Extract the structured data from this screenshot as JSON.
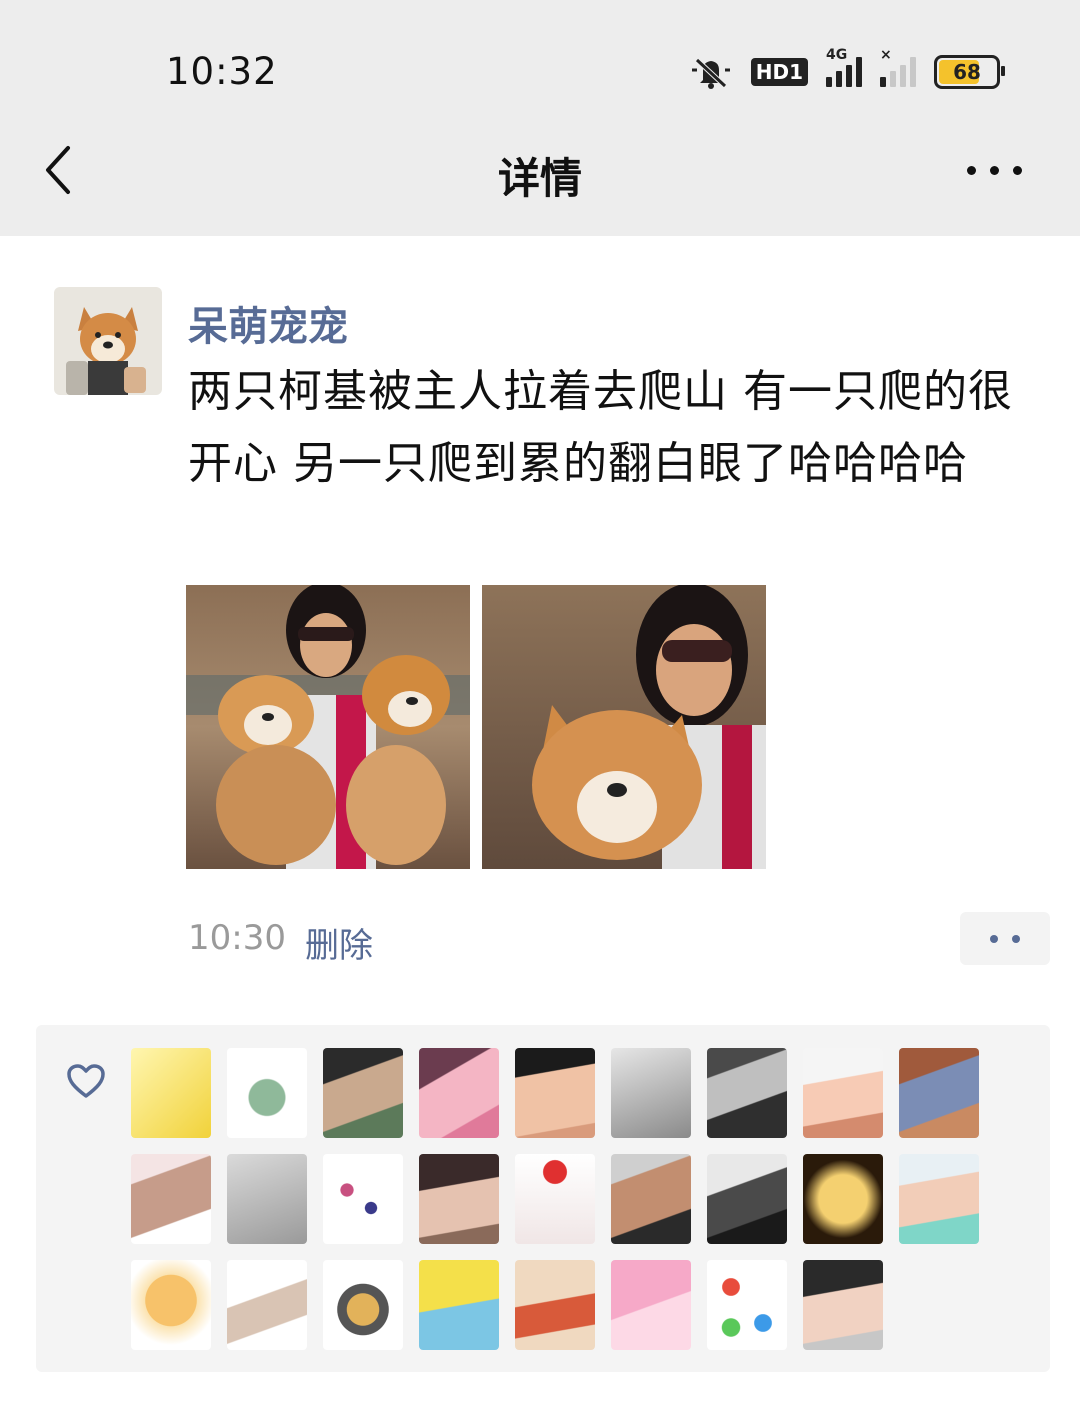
{
  "status_bar": {
    "time": "10:32",
    "hd_label": "HD1",
    "network_label": "4G",
    "battery": "68",
    "battery_color": "#f4c22c"
  },
  "header": {
    "title": "详情"
  },
  "post": {
    "author": "呆萌宠宠",
    "text": "两只柯基被主人拉着去爬山 有一只爬的很开心 另一只爬到累的翻白眼了哈哈哈哈",
    "time": "10:30",
    "delete_label": "删除",
    "link_color": "#576b95"
  },
  "likes": {
    "avatars": [
      {
        "name": "liker-1",
        "bg": "linear-gradient(135deg,#fff6b0,#f1d23a)"
      },
      {
        "name": "liker-2",
        "bg": "radial-gradient(circle at 50% 55%,#8fb99a 0 28%,#ffffff 30%)"
      },
      {
        "name": "liker-3",
        "bg": "linear-gradient(160deg,#2b2b2b 0 30%,#c9a98e 31% 70%,#5c7a5a 71%)"
      },
      {
        "name": "liker-4",
        "bg": "linear-gradient(150deg,#6b3c4f 0 30%,#f4b5c4 31% 75%,#e07a9a 76%)"
      },
      {
        "name": "liker-5",
        "bg": "linear-gradient(170deg,#1b1b1b 0 28%,#f0c2a5 29% 85%,#d99b7c 86%)"
      },
      {
        "name": "liker-6",
        "bg": "linear-gradient(160deg,#e6e6e6,#8a8a8a)"
      },
      {
        "name": "liker-7",
        "bg": "linear-gradient(160deg,#4a4a4a 0 25%,#bfbfbf 26% 60%,#2f2f2f 61%)"
      },
      {
        "name": "liker-8",
        "bg": "linear-gradient(170deg,#f5f5f5 0 35%,#f7cbb5 36% 75%,#d48b6e 76%)"
      },
      {
        "name": "liker-9",
        "bg": "linear-gradient(160deg,#a05a3c 0 30%,#7b8db5 31% 70%,#c98a62 71%)"
      },
      {
        "name": "liker-10",
        "bg": "linear-gradient(160deg,#f4e4e4 0 25%,#c69c8a 26% 70%,#ffffff 71%)"
      },
      {
        "name": "liker-11",
        "bg": "linear-gradient(160deg,#dadada,#9a9a9a)"
      },
      {
        "name": "liker-12",
        "bg": "radial-gradient(circle at 30% 40%,#c85080 0 8%,transparent 9%),radial-gradient(circle at 60% 60%,#3a3a8a 0 8%,transparent 9%),#ffffff"
      },
      {
        "name": "liker-13",
        "bg": "linear-gradient(170deg,#3a2a2a 0 35%,#e5c2b0 36% 80%,#8a6a5a 81%)"
      },
      {
        "name": "liker-14",
        "bg": "radial-gradient(circle at 50% 20%,#e03030 0 14%,transparent 15%),linear-gradient(#ffffff,#f0e6e6)"
      },
      {
        "name": "liker-15",
        "bg": "linear-gradient(160deg,#cfcfcf 0 25%,#c28e70 26% 70%,#2a2a2a 71%)"
      },
      {
        "name": "liker-16",
        "bg": "linear-gradient(160deg,#e8e8e8 0 35%,#4a4a4a 36% 70%,#1a1a1a 71%)"
      },
      {
        "name": "liker-17",
        "bg": "radial-gradient(circle,#f4d070 0 40%,#2a1a0a 65%)"
      },
      {
        "name": "liker-18",
        "bg": "linear-gradient(170deg,#e8f0f4 0 30%,#f2cdb8 31% 70%,#7fd6c8 71%)"
      },
      {
        "name": "liker-19",
        "bg": "radial-gradient(circle at 50% 45%,#f7c26a 0 40%,#fbe3b0 41%,#ffffff 70%)"
      },
      {
        "name": "liker-20",
        "bg": "linear-gradient(160deg,#ffffff 0 40%,#d9c4b4 41% 70%,#ffffff 71%)"
      },
      {
        "name": "liker-21",
        "bg": "radial-gradient(circle at 50% 55%,#e2b25a 0 25%,#555 26% 40%,#ffffff 41%)"
      },
      {
        "name": "liker-22",
        "bg": "linear-gradient(170deg,#f4e04a 0 50%,#7cc6e4 51%)"
      },
      {
        "name": "liker-23",
        "bg": "linear-gradient(170deg,#f0d9c0 0 45%,#d85a3a 46% 75%,#f0d9c0 76%)"
      },
      {
        "name": "liker-24",
        "bg": "linear-gradient(160deg,#f6a9c8 0 50%,#fdd9e6 51%)"
      },
      {
        "name": "liker-25",
        "bg": "radial-gradient(circle at 30% 30%,#e84c3c 0 10%,transparent 11%),radial-gradient(circle at 70% 70%,#3c9ae8 0 10%,transparent 11%),radial-gradient(circle at 30% 75%,#5ac85a 0 10%,transparent 11%),#ffffff"
      },
      {
        "name": "liker-26",
        "bg": "linear-gradient(170deg,#2a2a2a 0 35%,#f1d2c2 36% 80%,#c7c7c7 81%)"
      }
    ]
  }
}
